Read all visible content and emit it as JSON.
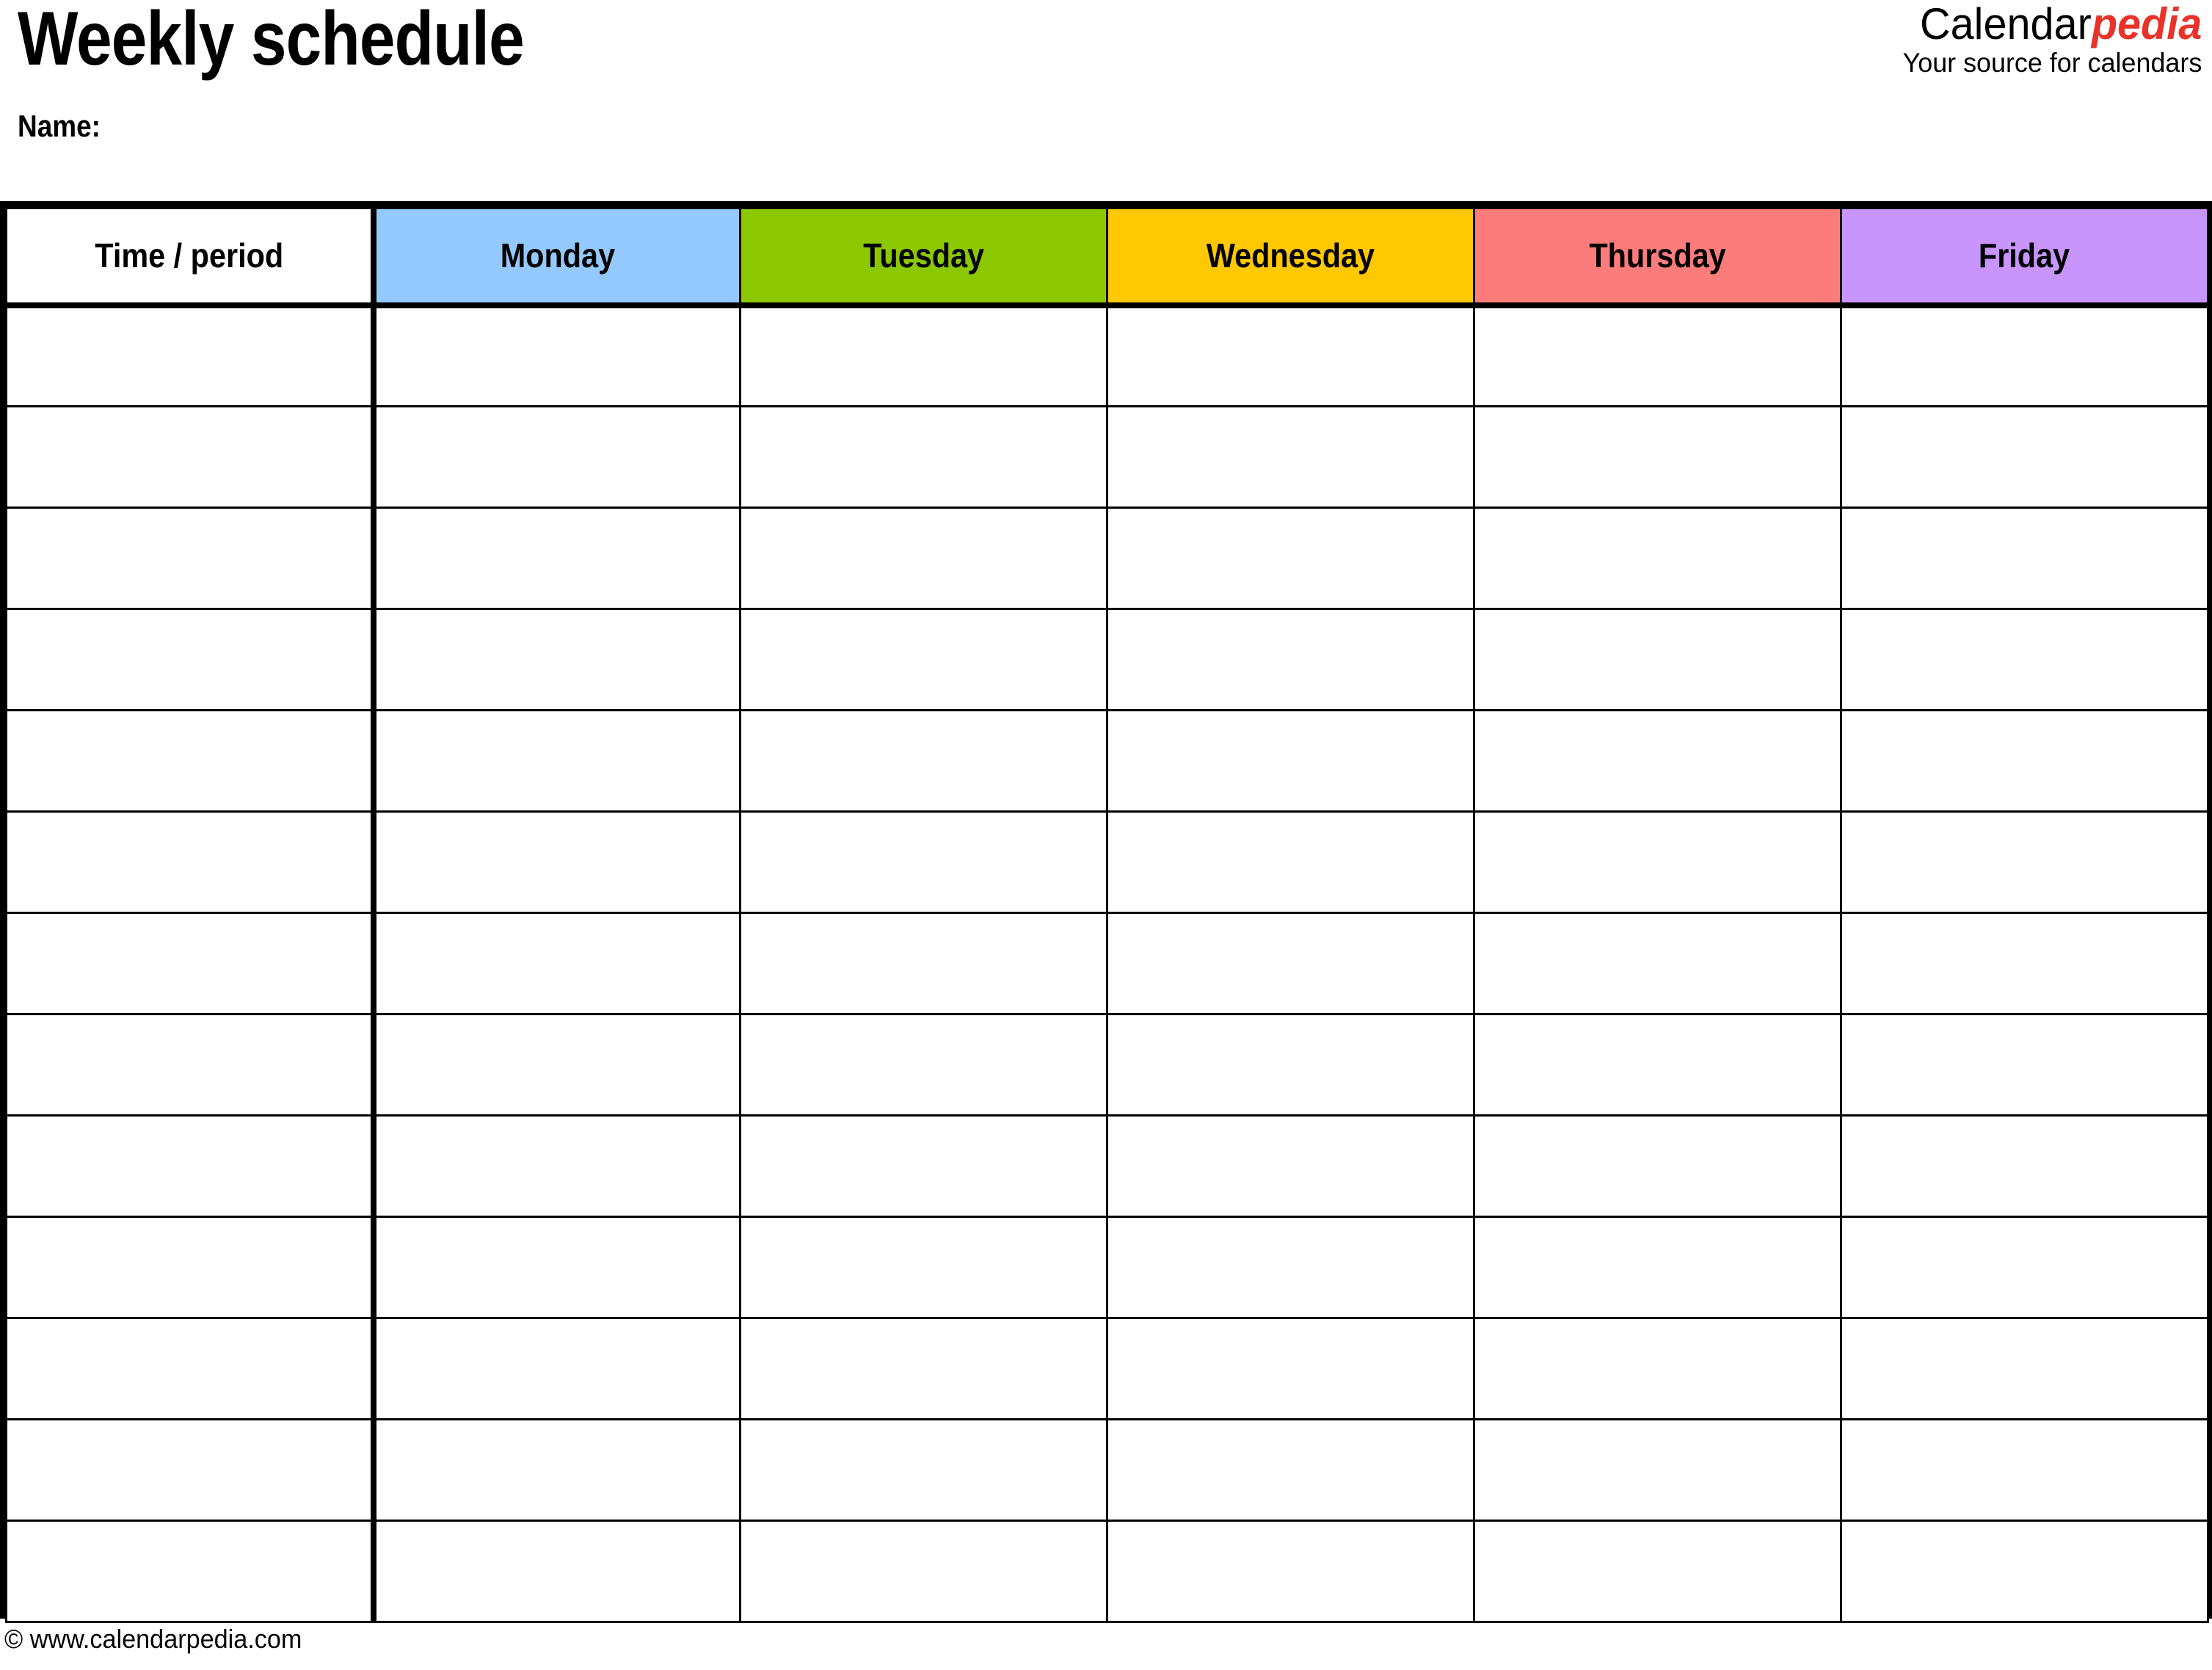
{
  "document": {
    "title": "Weekly schedule",
    "name_label": "Name:",
    "name_value": ""
  },
  "brand": {
    "name_part1": "Calendar",
    "name_part2": "pedia",
    "tagline": "Your source for calendars",
    "accent_color": "#E8322A",
    "text_color": "#000000"
  },
  "schedule": {
    "columns": [
      {
        "key": "time",
        "label": "Time / period",
        "header_color": "#FFFFFF"
      },
      {
        "key": "monday",
        "label": "Monday",
        "header_color": "#93C9FC"
      },
      {
        "key": "tuesday",
        "label": "Tuesday",
        "header_color": "#8CC800"
      },
      {
        "key": "wednesday",
        "label": "Wednesday",
        "header_color": "#FFC800"
      },
      {
        "key": "thursday",
        "label": "Thursday",
        "header_color": "#FC7C7C"
      },
      {
        "key": "friday",
        "label": "Friday",
        "header_color": "#C795FC"
      }
    ],
    "row_count": 13,
    "rows": [
      {
        "time": "",
        "monday": "",
        "tuesday": "",
        "wednesday": "",
        "thursday": "",
        "friday": ""
      },
      {
        "time": "",
        "monday": "",
        "tuesday": "",
        "wednesday": "",
        "thursday": "",
        "friday": ""
      },
      {
        "time": "",
        "monday": "",
        "tuesday": "",
        "wednesday": "",
        "thursday": "",
        "friday": ""
      },
      {
        "time": "",
        "monday": "",
        "tuesday": "",
        "wednesday": "",
        "thursday": "",
        "friday": ""
      },
      {
        "time": "",
        "monday": "",
        "tuesday": "",
        "wednesday": "",
        "thursday": "",
        "friday": ""
      },
      {
        "time": "",
        "monday": "",
        "tuesday": "",
        "wednesday": "",
        "thursday": "",
        "friday": ""
      },
      {
        "time": "",
        "monday": "",
        "tuesday": "",
        "wednesday": "",
        "thursday": "",
        "friday": ""
      },
      {
        "time": "",
        "monday": "",
        "tuesday": "",
        "wednesday": "",
        "thursday": "",
        "friday": ""
      },
      {
        "time": "",
        "monday": "",
        "tuesday": "",
        "wednesday": "",
        "thursday": "",
        "friday": ""
      },
      {
        "time": "",
        "monday": "",
        "tuesday": "",
        "wednesday": "",
        "thursday": "",
        "friday": ""
      },
      {
        "time": "",
        "monday": "",
        "tuesday": "",
        "wednesday": "",
        "thursday": "",
        "friday": ""
      },
      {
        "time": "",
        "monday": "",
        "tuesday": "",
        "wednesday": "",
        "thursday": "",
        "friday": ""
      },
      {
        "time": "",
        "monday": "",
        "tuesday": "",
        "wednesday": "",
        "thursday": "",
        "friday": ""
      }
    ]
  },
  "footer": {
    "copyright": "© www.calendarpedia.com"
  }
}
